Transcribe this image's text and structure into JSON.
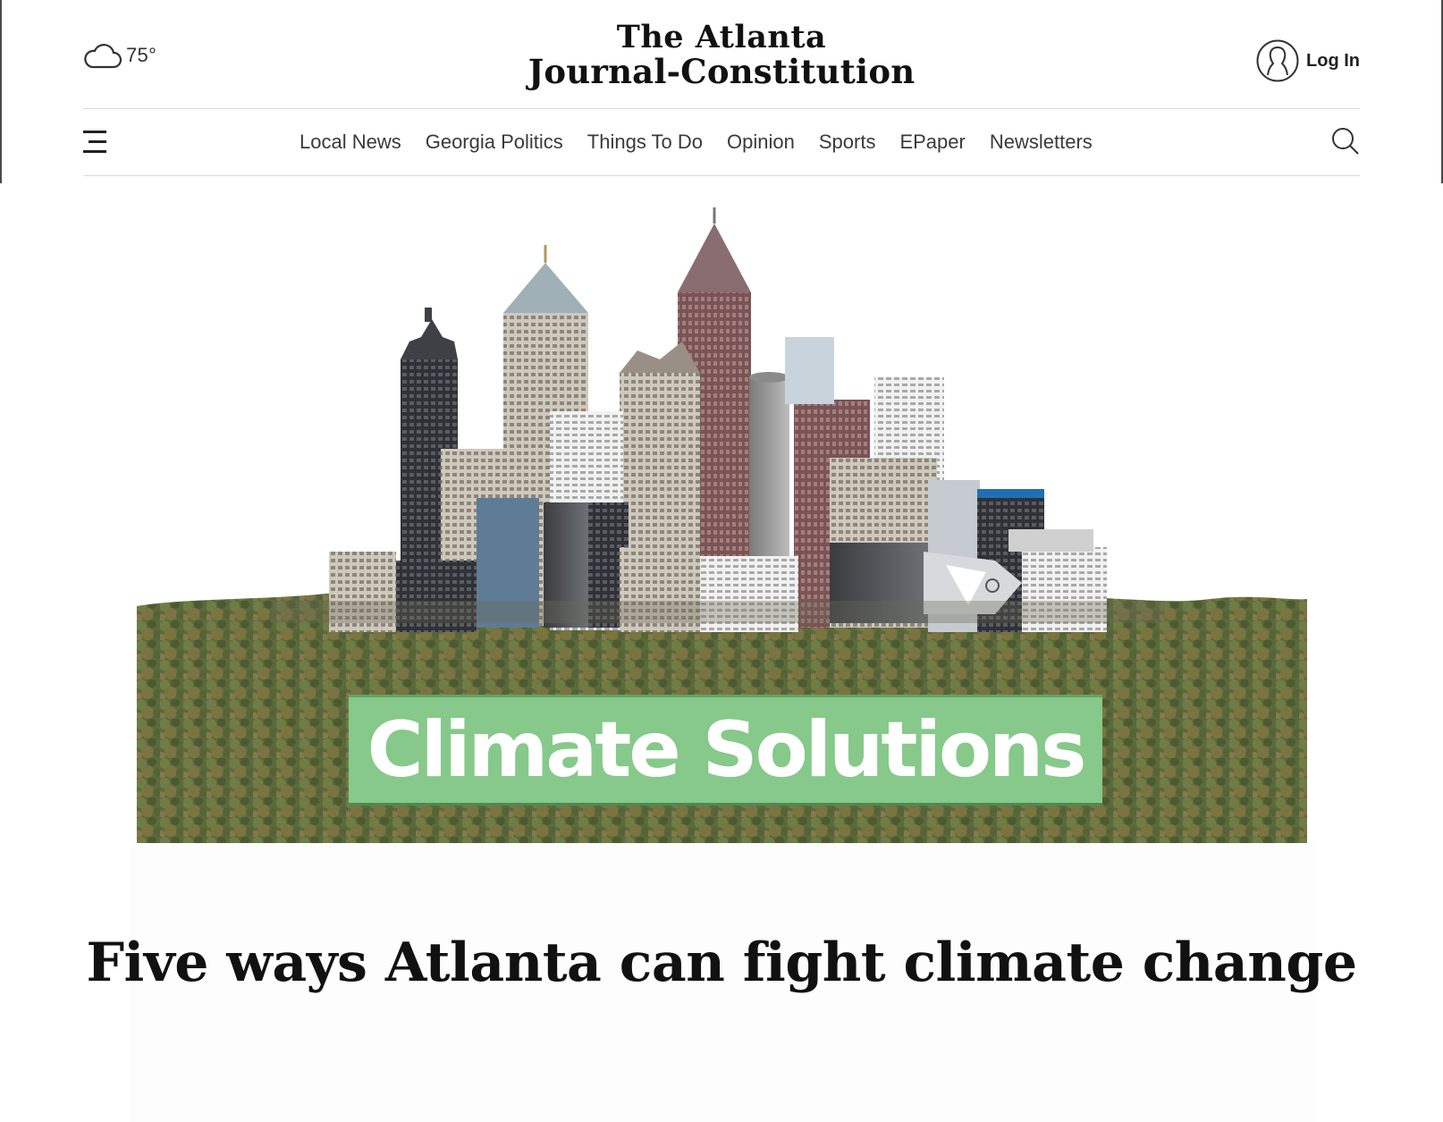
{
  "header": {
    "weather": {
      "icon": "cloud-icon",
      "temperature": "75°"
    },
    "logo": {
      "line1": "The Atlanta",
      "line2": "Journal-Constitution"
    },
    "login": {
      "icon": "user-icon",
      "label": "Log In"
    }
  },
  "nav": {
    "menu_icon": "hamburger-menu-icon",
    "items": [
      {
        "label": "Local News"
      },
      {
        "label": "Georgia Politics"
      },
      {
        "label": "Things To Do"
      },
      {
        "label": "Opinion"
      },
      {
        "label": "Sports"
      },
      {
        "label": "EPaper"
      },
      {
        "label": "Newsletters"
      }
    ],
    "search_icon": "search-icon"
  },
  "hero": {
    "image_description_icon": "atlanta-skyline-illustration",
    "title": "Climate Solutions",
    "title_bg_color": "#86c98a"
  },
  "article": {
    "headline": "Five ways Atlanta can fight climate change"
  },
  "colors": {
    "divider": "#d9d9d9",
    "forest": "#5d6b3a"
  }
}
